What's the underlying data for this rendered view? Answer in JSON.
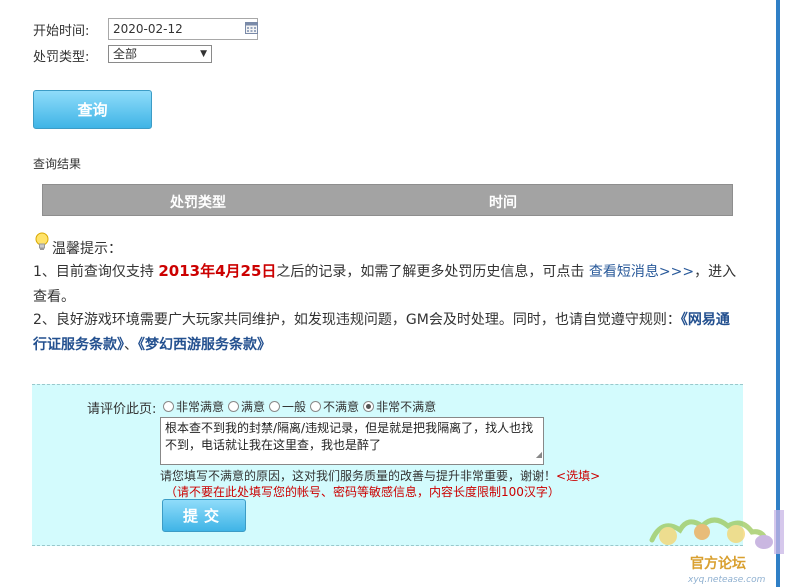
{
  "form": {
    "start_time_label": "开始时间:",
    "start_date_value": "2020-02-12",
    "penalty_type_label": "处罚类型:",
    "penalty_type_selected": "全部",
    "query_button": "查询"
  },
  "results": {
    "label": "查询结果",
    "columns": [
      "处罚类型",
      "时间"
    ]
  },
  "tips": {
    "title": "温馨提示：",
    "line1_prefix": "1、目前查询仅支持 ",
    "line1_date": "2013年4月25日",
    "line1_middle": "之后的记录，如需了解更多处罚历史信息，可点击 ",
    "line1_link": "查看短消息>>>",
    "line1_suffix": "，进入查看。",
    "line2_prefix": "2、良好游戏环境需要广大玩家共同维护，如发现违规问题，GM会及时处理。同时，也请自觉遵守规则：",
    "line2_link1": "《网易通行证服务条款》",
    "line2_sep": "、",
    "line2_link2": "《梦幻西游服务条款》"
  },
  "feedback": {
    "rate_label": "请评价此页:",
    "options": [
      "非常满意",
      "满意",
      "一般",
      "不满意",
      "非常不满意"
    ],
    "selected_index": 4,
    "text_value": "根本查不到我的封禁/隔离/违规记录，但是就是把我隔离了，找人也找不到，电话就让我在这里查，我也是醉了",
    "hint_main": "请您填写不满意的原因，这对我们服务质量的改善与提升非常重要，谢谢！",
    "hint_optional": "<选填>",
    "hint_warning": "（请不要在此处填写您的帐号、密码等敏感信息，内容长度限制100汉字）",
    "submit_button": "提交"
  },
  "watermark": {
    "site": "xyq.netease.com",
    "caption": "官方论坛"
  },
  "colors": {
    "accent_button": "#3fb4e6",
    "table_header": "#a3a3a3",
    "feedback_bg": "#d3fbfd",
    "warning_red": "#cc0000",
    "link_blue": "#2a5a9a"
  }
}
